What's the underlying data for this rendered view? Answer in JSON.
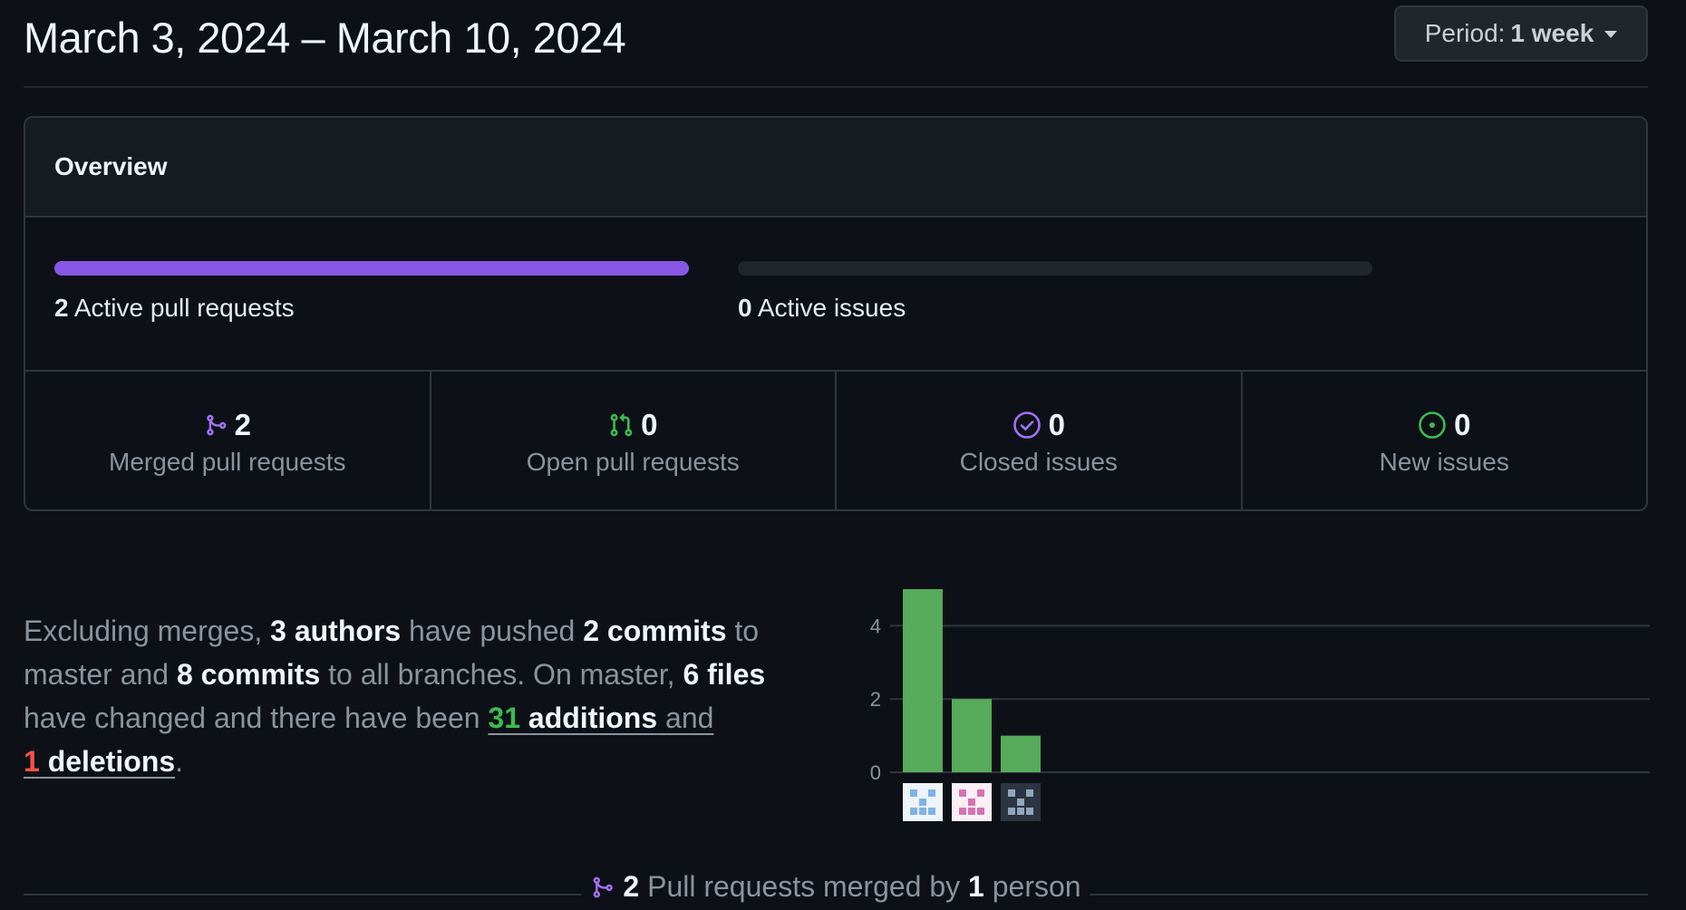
{
  "header": {
    "date_range": "March 3, 2024 – March 10, 2024",
    "period_prefix": "Period:",
    "period_value": "1 week"
  },
  "overview": {
    "title": "Overview",
    "pull_requests": {
      "count": "2",
      "label": "Active pull requests",
      "fill_fraction": 1.0
    },
    "issues": {
      "count": "0",
      "label": "Active issues",
      "fill_fraction": 0.0
    },
    "stats": [
      {
        "count": "2",
        "label": "Merged pull requests",
        "icon": "git-merge-icon",
        "color": "#a371f7"
      },
      {
        "count": "0",
        "label": "Open pull requests",
        "icon": "git-pull-request-icon",
        "color": "#3fb950"
      },
      {
        "count": "0",
        "label": "Closed issues",
        "icon": "issue-closed-icon",
        "color": "#a371f7"
      },
      {
        "count": "0",
        "label": "New issues",
        "icon": "issue-opened-icon",
        "color": "#3fb950"
      }
    ]
  },
  "summary": {
    "t1": "Excluding merges, ",
    "authors": "3 authors",
    "t2": " have pushed ",
    "commits_master": "2 commits",
    "t3": " to master and ",
    "commits_all": "8 commits",
    "t4": " to all branches. On master, ",
    "files": "6 files",
    "t5": " have changed and there have been ",
    "additions_num": "31",
    "additions_word": " additions",
    "and_word": " and",
    "deletions_num": "1",
    "deletions_word": " deletions",
    "t6": "."
  },
  "chart_data": {
    "type": "bar",
    "categories": [
      "author-1",
      "author-2",
      "author-3"
    ],
    "values": [
      5,
      2,
      1
    ],
    "ylim": [
      0,
      5
    ],
    "y_ticks": [
      "0",
      "2",
      "4"
    ],
    "grid": true,
    "bar_color": "#57ab5a"
  },
  "footer": {
    "count": "2",
    "t1": " Pull requests merged by ",
    "people": "1",
    "t2": " person"
  }
}
